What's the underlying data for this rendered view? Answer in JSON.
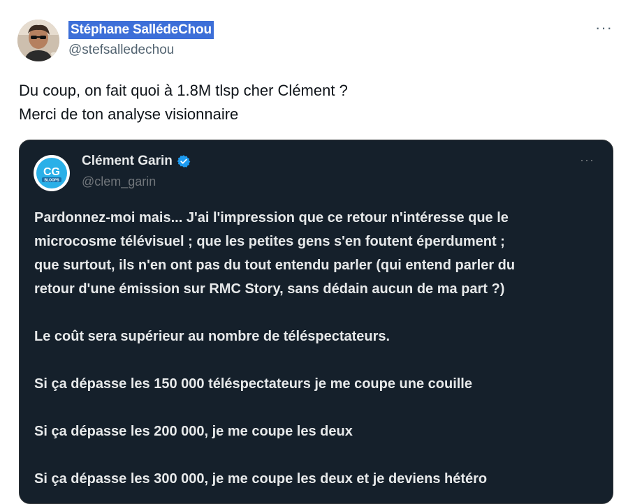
{
  "tweet": {
    "display_name": "Stéphane SallédeChou",
    "handle": "@stefsalledechou",
    "text_lines": [
      "Du coup, on fait quoi à 1.8M tlsp cher Clément ?",
      "Merci de ton analyse visionnaire"
    ],
    "more_icon": "more-horizontal-icon"
  },
  "quoted": {
    "display_name": "Clément Garin",
    "handle": "@clem_garin",
    "avatar_text": "CG",
    "avatar_subtext": "BLOOPS",
    "verified_icon": "verified-badge-icon",
    "verified_color": "#1d9bf0",
    "avatar_color": "#2ab0e8",
    "paragraphs": [
      [
        "Pardonnez-moi mais... J'ai l'impression que ce retour n'intéresse que le",
        "microcosme télévisuel ; que les petites gens s'en foutent éperdument ;",
        "que surtout, ils n'en ont pas du tout entendu parler (qui entend parler du",
        "retour d'une émission sur RMC Story, sans dédain aucun de ma part ?)"
      ],
      [
        "Le coût sera supérieur au nombre de téléspectateurs."
      ],
      [
        "Si ça dépasse les 150 000 téléspectateurs je me coupe une couille"
      ],
      [
        "Si ça dépasse les 200 000, je me coupe les deux"
      ],
      [
        "Si ça dépasse les 300 000, je me coupe les deux et je deviens hétéro"
      ]
    ]
  }
}
